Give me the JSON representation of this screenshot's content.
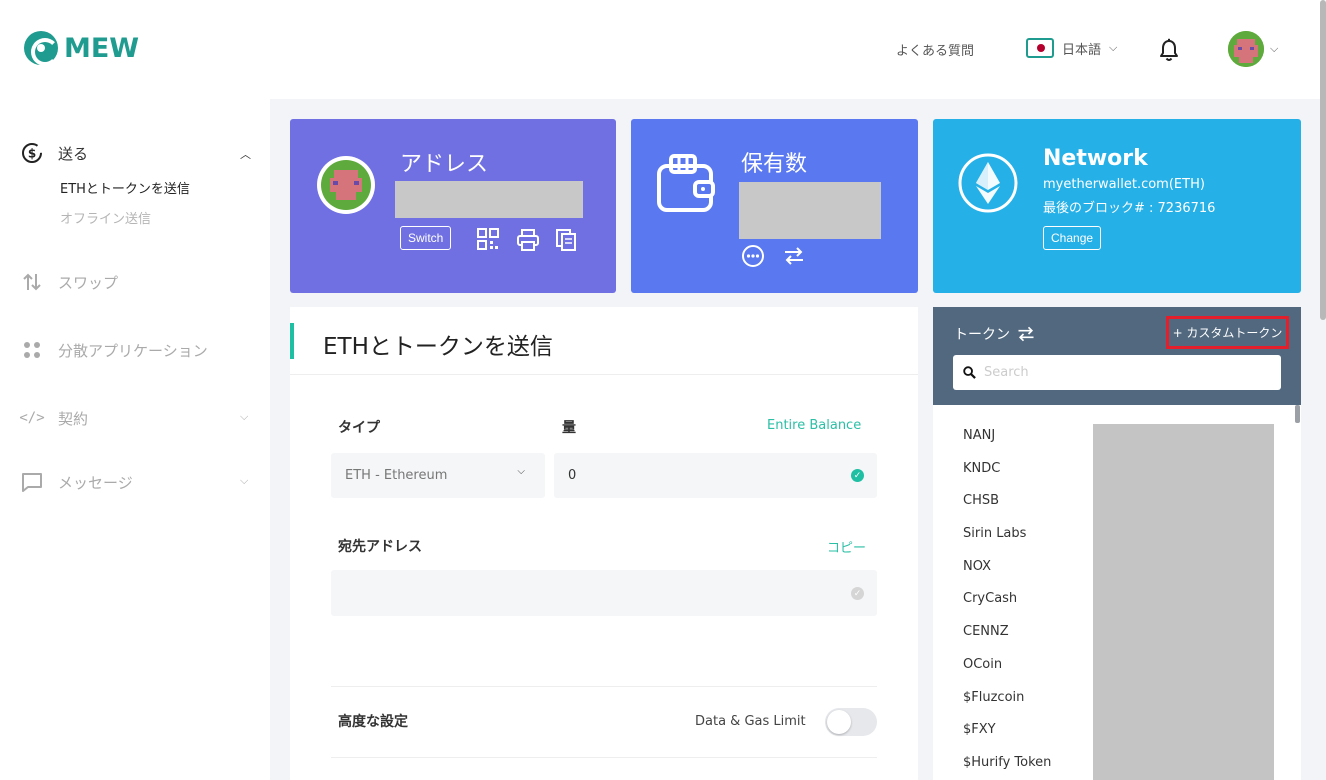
{
  "header": {
    "brand": "MEW",
    "faq_label": "よくある質問",
    "language_label": "日本語"
  },
  "sidebar": {
    "items": [
      {
        "label": "送る",
        "icon": "send-icon"
      },
      {
        "label": "スワップ",
        "icon": "swap-icon"
      },
      {
        "label": "分散アプリケーション",
        "icon": "dapps-icon"
      },
      {
        "label": "契約",
        "icon": "contract-icon"
      },
      {
        "label": "メッセージ",
        "icon": "message-icon"
      }
    ],
    "sub_items": [
      {
        "label": "ETHとトークンを送信"
      },
      {
        "label": "オフライン送信"
      }
    ]
  },
  "cards": {
    "address": {
      "title": "アドレス",
      "switch_label": "Switch"
    },
    "balance": {
      "title": "保有数"
    },
    "network": {
      "title": "Network",
      "node": "myetherwallet.com(ETH)",
      "last_block": "最後のブロック# : 7236716",
      "change_label": "Change"
    }
  },
  "send": {
    "title": "ETHとトークンを送信",
    "type_label": "タイプ",
    "amount_label": "量",
    "entire_balance": "Entire Balance",
    "token_select": "ETH - Ethereum",
    "amount_value": "0",
    "to_address_label": "宛先アドレス",
    "copy_label": "コピー",
    "to_address_value": "",
    "advanced_label": "高度な設定",
    "data_gas_label": "Data & Gas Limit"
  },
  "tokens": {
    "title": "トークン",
    "custom_token_label": "+ カスタムトークン",
    "search_placeholder": "Search",
    "list": [
      "NANJ",
      "KNDC",
      "CHSB",
      "Sirin Labs",
      "NOX",
      "CryCash",
      "CENNZ",
      "OCoin",
      "$Fluzcoin",
      "$FXY",
      "$Hurify Token"
    ]
  },
  "colors": {
    "brand": "#1f9c8f",
    "accent": "#2bbfa5",
    "address_card": "#7070e3",
    "balance_card": "#5a78f0",
    "network_card": "#25b0e8",
    "token_header": "#51687f",
    "highlight": "#e41f2b"
  }
}
